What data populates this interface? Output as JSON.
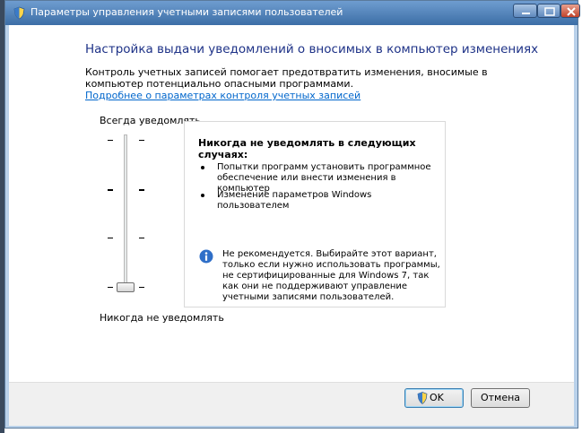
{
  "window": {
    "title": "Параметры управления учетными записями пользователей"
  },
  "content": {
    "heading": "Настройка выдачи уведомлений о вносимых в компьютер изменениях",
    "description": "Контроль учетных записей помогает предотвратить изменения, вносимые в компьютер потенциально опасными программами.",
    "link": "Подробнее о параметрах контроля учетных записей"
  },
  "slider": {
    "top_label": "Всегда уведомлять",
    "bottom_label": "Никогда не уведомлять",
    "level": 0,
    "levels": 4
  },
  "panel": {
    "title": "Никогда не уведомлять в следующих случаях:",
    "bullets": [
      "Попытки программ установить программное обеспечение или внести изменения в компьютер",
      "Изменение параметров Windows пользователем"
    ],
    "warning": "Не рекомендуется. Выбирайте этот вариант, только если нужно использовать программы, не сертифицированные для Windows 7, так как они не поддерживают управление учетными записями пользователей."
  },
  "buttons": {
    "ok": "OK",
    "cancel": "Отмена"
  },
  "colors": {
    "heading": "#1e3287",
    "link": "#0066cc",
    "titlebar": "#3c6ea6"
  }
}
